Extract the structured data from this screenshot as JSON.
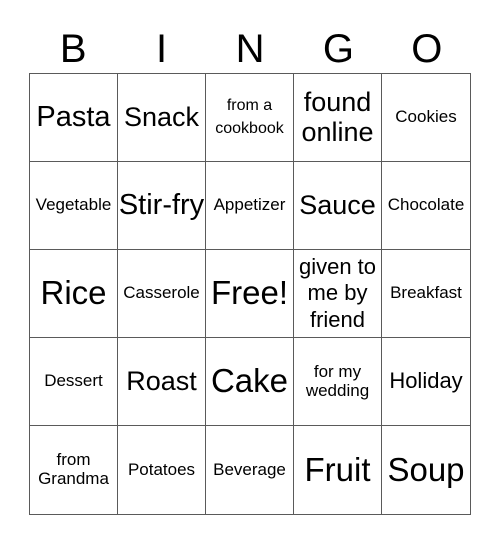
{
  "header": {
    "letters": [
      "B",
      "I",
      "N",
      "G",
      "O"
    ]
  },
  "cells": [
    {
      "text": "Pasta",
      "size": "s-l"
    },
    {
      "text": "Snack",
      "size": "s-lm"
    },
    {
      "text": "from a cookbook",
      "size": "s-xs"
    },
    {
      "text": "found online",
      "size": "s-lm"
    },
    {
      "text": "Cookies",
      "size": "s-s"
    },
    {
      "text": "Vegetable",
      "size": "s-s"
    },
    {
      "text": "Stir-fry",
      "size": "s-l"
    },
    {
      "text": "Appetizer",
      "size": "s-s"
    },
    {
      "text": "Sauce",
      "size": "s-lm"
    },
    {
      "text": "Chocolate",
      "size": "s-s"
    },
    {
      "text": "Rice",
      "size": "s-xl"
    },
    {
      "text": "Casserole",
      "size": "s-s"
    },
    {
      "text": "Free!",
      "size": "s-xl"
    },
    {
      "text": "given to me by friend",
      "size": "s-m"
    },
    {
      "text": "Breakfast",
      "size": "s-s"
    },
    {
      "text": "Dessert",
      "size": "s-s"
    },
    {
      "text": "Roast",
      "size": "s-lm"
    },
    {
      "text": "Cake",
      "size": "s-xl"
    },
    {
      "text": "for my wedding",
      "size": "s-s"
    },
    {
      "text": "Holiday",
      "size": "s-m"
    },
    {
      "text": "from Grandma",
      "size": "s-s"
    },
    {
      "text": "Potatoes",
      "size": "s-s"
    },
    {
      "text": "Beverage",
      "size": "s-s"
    },
    {
      "text": "Fruit",
      "size": "s-xl"
    },
    {
      "text": "Soup",
      "size": "s-xl"
    }
  ]
}
